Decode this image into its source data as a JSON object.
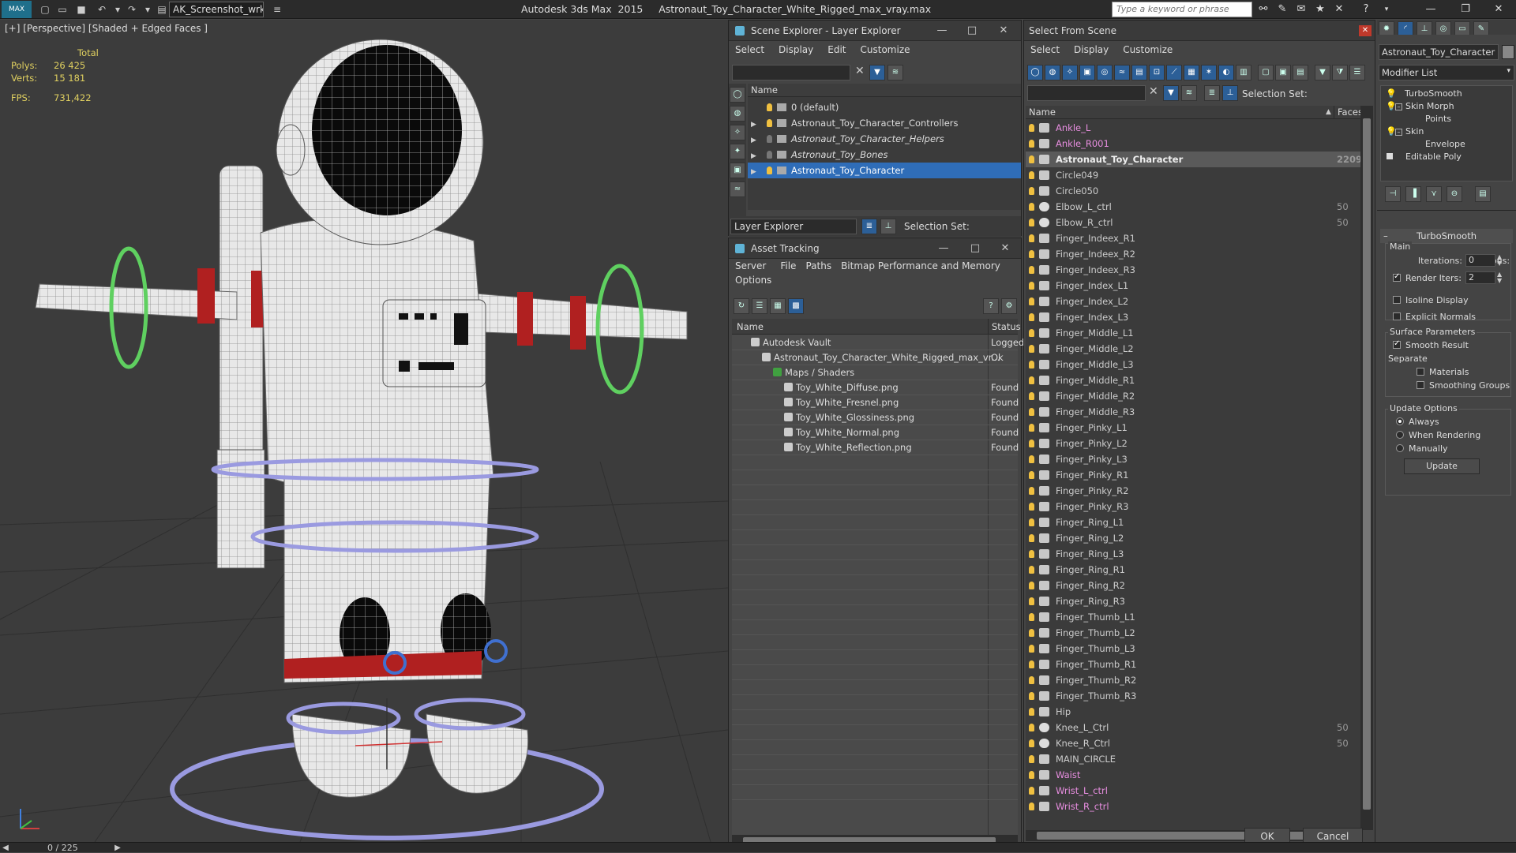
{
  "app": {
    "title": "Autodesk 3ds Max  2015     Astronaut_Toy_Character_White_Rigged_max_vray.max",
    "logo": "MAX",
    "workspace": "AK_Screenshot_wrksp",
    "search_placeholder": "Type a keyword or phrase"
  },
  "viewport": {
    "label": "[+] [Perspective] [Shaded + Edged Faces ]",
    "stats": {
      "total_label": "Total",
      "polys_label": "Polys:",
      "polys": "26 425",
      "verts_label": "Verts:",
      "verts": "15 181",
      "fps_label": "FPS:",
      "fps": "731,422"
    },
    "timeline": "0 / 225"
  },
  "scene_explorer": {
    "title": "Scene Explorer - Layer Explorer",
    "menu": [
      "Select",
      "Display",
      "Edit",
      "Customize"
    ],
    "col_name": "Name",
    "layers": [
      {
        "name": "0 (default)",
        "italic": false,
        "expand": false,
        "on": true
      },
      {
        "name": "Astronaut_Toy_Character_Controllers",
        "italic": false,
        "expand": true,
        "on": true
      },
      {
        "name": "Astronaut_Toy_Character_Helpers",
        "italic": true,
        "expand": true,
        "on": false
      },
      {
        "name": "Astronaut_Toy_Bones",
        "italic": true,
        "expand": true,
        "on": false
      },
      {
        "name": "Astronaut_Toy_Character",
        "italic": false,
        "expand": true,
        "on": true,
        "selected": true
      }
    ],
    "footer_dropdown": "Layer Explorer",
    "selection_set": "Selection Set:"
  },
  "asset_tracking": {
    "title": "Asset Tracking",
    "menu_row1": [
      "Server",
      "File",
      "Paths",
      "Bitmap Performance and Memory"
    ],
    "menu_row2": [
      "Options"
    ],
    "col_name": "Name",
    "col_status": "Status",
    "rows": [
      {
        "name": "Autodesk Vault",
        "indent": 1,
        "status": "Logged"
      },
      {
        "name": "Astronaut_Toy_Character_White_Rigged_max_vr...",
        "indent": 2,
        "status": "Ok"
      },
      {
        "name": "Maps / Shaders",
        "indent": 3,
        "status": ""
      },
      {
        "name": "Toy_White_Diffuse.png",
        "indent": 4,
        "status": "Found"
      },
      {
        "name": "Toy_White_Fresnel.png",
        "indent": 4,
        "status": "Found"
      },
      {
        "name": "Toy_White_Glossiness.png",
        "indent": 4,
        "status": "Found"
      },
      {
        "name": "Toy_White_Normal.png",
        "indent": 4,
        "status": "Found"
      },
      {
        "name": "Toy_White_Reflection.png",
        "indent": 4,
        "status": "Found"
      }
    ]
  },
  "select_from_scene": {
    "title": "Select From Scene",
    "menu": [
      "Select",
      "Display",
      "Customize"
    ],
    "selection_set": "Selection Set:",
    "col_name": "Name",
    "col_faces": "Faces",
    "items": [
      {
        "name": "Ankle_L",
        "pink": true,
        "faces": ""
      },
      {
        "name": "Ankle_R001",
        "pink": true,
        "faces": ""
      },
      {
        "name": "Astronaut_Toy_Character",
        "selected": true,
        "faces": "2209"
      },
      {
        "name": "Circle049",
        "faces": ""
      },
      {
        "name": "Circle050",
        "faces": ""
      },
      {
        "name": "Elbow_L_ctrl",
        "round": true,
        "faces": "50"
      },
      {
        "name": "Elbow_R_ctrl",
        "round": true,
        "faces": "50"
      },
      {
        "name": "Finger_Indeex_R1",
        "faces": ""
      },
      {
        "name": "Finger_Indeex_R2",
        "faces": ""
      },
      {
        "name": "Finger_Indeex_R3",
        "faces": ""
      },
      {
        "name": "Finger_Index_L1",
        "faces": ""
      },
      {
        "name": "Finger_Index_L2",
        "faces": ""
      },
      {
        "name": "Finger_Index_L3",
        "faces": ""
      },
      {
        "name": "Finger_Middle_L1",
        "faces": ""
      },
      {
        "name": "Finger_Middle_L2",
        "faces": ""
      },
      {
        "name": "Finger_Middle_L3",
        "faces": ""
      },
      {
        "name": "Finger_Middle_R1",
        "faces": ""
      },
      {
        "name": "Finger_Middle_R2",
        "faces": ""
      },
      {
        "name": "Finger_Middle_R3",
        "faces": ""
      },
      {
        "name": "Finger_Pinky_L1",
        "faces": ""
      },
      {
        "name": "Finger_Pinky_L2",
        "faces": ""
      },
      {
        "name": "Finger_Pinky_L3",
        "faces": ""
      },
      {
        "name": "Finger_Pinky_R1",
        "faces": ""
      },
      {
        "name": "Finger_Pinky_R2",
        "faces": ""
      },
      {
        "name": "Finger_Pinky_R3",
        "faces": ""
      },
      {
        "name": "Finger_Ring_L1",
        "faces": ""
      },
      {
        "name": "Finger_Ring_L2",
        "faces": ""
      },
      {
        "name": "Finger_Ring_L3",
        "faces": ""
      },
      {
        "name": "Finger_Ring_R1",
        "faces": ""
      },
      {
        "name": "Finger_Ring_R2",
        "faces": ""
      },
      {
        "name": "Finger_Ring_R3",
        "faces": ""
      },
      {
        "name": "Finger_Thumb_L1",
        "faces": ""
      },
      {
        "name": "Finger_Thumb_L2",
        "faces": ""
      },
      {
        "name": "Finger_Thumb_L3",
        "faces": ""
      },
      {
        "name": "Finger_Thumb_R1",
        "faces": ""
      },
      {
        "name": "Finger_Thumb_R2",
        "faces": ""
      },
      {
        "name": "Finger_Thumb_R3",
        "faces": ""
      },
      {
        "name": "Hip",
        "faces": ""
      },
      {
        "name": "Knee_L_Ctrl",
        "round": true,
        "faces": "50"
      },
      {
        "name": "Knee_R_Ctrl",
        "round": true,
        "faces": "50"
      },
      {
        "name": "MAIN_CIRCLE",
        "faces": ""
      },
      {
        "name": "Waist",
        "pink": true,
        "faces": ""
      },
      {
        "name": "Wrist_L_ctrl",
        "pink": true,
        "faces": ""
      },
      {
        "name": "Wrist_R_ctrl",
        "pink": true,
        "faces": ""
      }
    ],
    "ok": "OK",
    "cancel": "Cancel"
  },
  "command_panel": {
    "object_name": "Astronaut_Toy_Character",
    "modifier_list": "Modifier List",
    "stack": [
      {
        "name": "TurboSmooth",
        "level": 0,
        "eye": true
      },
      {
        "name": "Skin Morph",
        "level": 0,
        "eye": true,
        "box": true
      },
      {
        "name": "Points",
        "level": 2
      },
      {
        "name": "Skin",
        "level": 0,
        "eye": true,
        "box": true
      },
      {
        "name": "Envelope",
        "level": 2
      },
      {
        "name": "Editable Poly",
        "level": 0,
        "square": true
      }
    ],
    "rollout_title": "TurboSmooth",
    "main_label": "Main",
    "iterations_label": "Iterations:",
    "iterations": "0",
    "render_iters_label": "Render Iters:",
    "render_iters": "2",
    "isoline": "Isoline Display",
    "explicit_normals": "Explicit Normals",
    "surface_params": "Surface Parameters",
    "smooth_result": "Smooth Result",
    "separate": "Separate",
    "materials": "Materials",
    "smoothing_groups": "Smoothing Groups",
    "update_options": "Update Options",
    "always": "Always",
    "when_rendering": "When Rendering",
    "manually": "Manually",
    "update_btn": "Update"
  },
  "colors": {
    "selection": "#2f6db8",
    "pink_item": "#e88ee0",
    "stats_yellow": "#e0d060"
  }
}
